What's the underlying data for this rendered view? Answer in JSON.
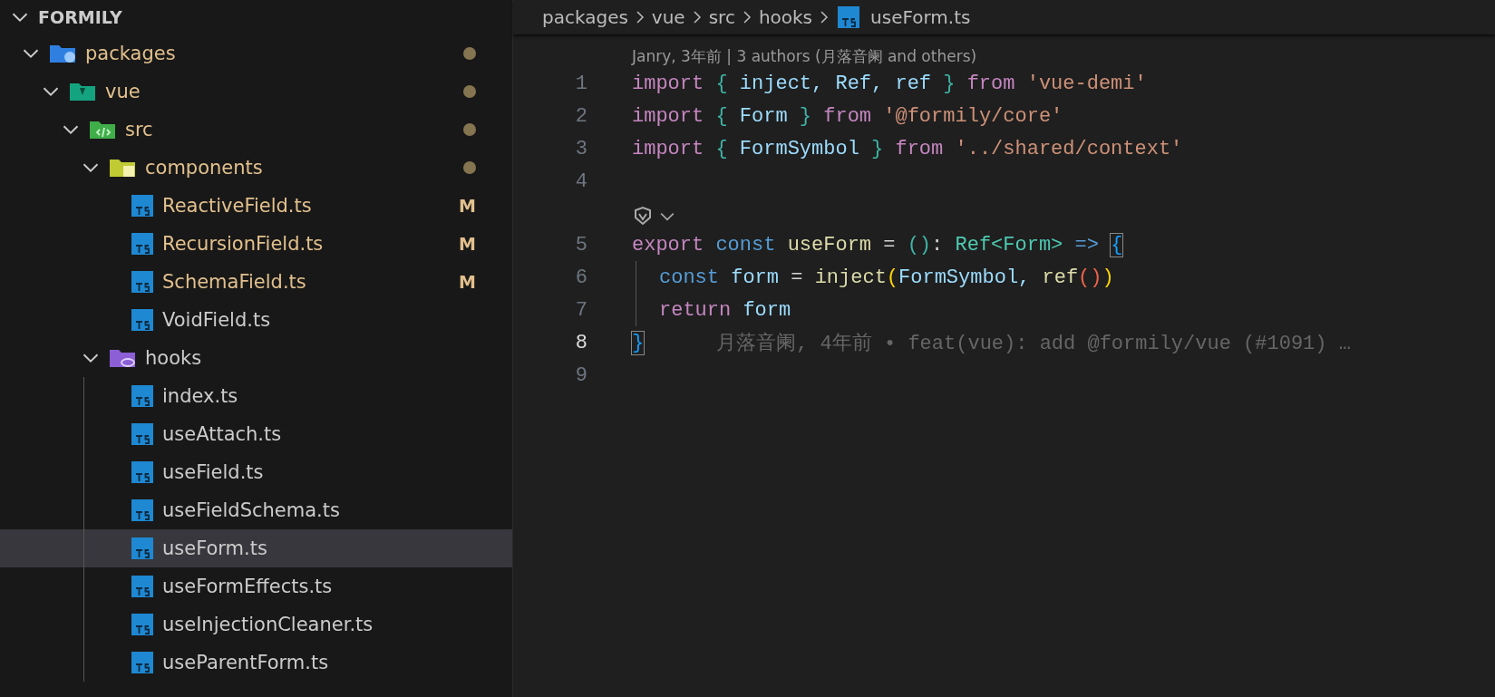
{
  "explorer": {
    "title": "FORMILY",
    "expanded": true,
    "tree": [
      {
        "name": "packages",
        "kind": "package-folder",
        "expanded": true,
        "modified": true,
        "selected": false,
        "children": [
          {
            "name": "vue",
            "kind": "vue-folder",
            "expanded": true,
            "modified": true,
            "selected": false,
            "children": [
              {
                "name": "src",
                "kind": "src-folder",
                "expanded": true,
                "modified": true,
                "selected": false,
                "children": [
                  {
                    "name": "components",
                    "kind": "components-folder",
                    "expanded": true,
                    "modified": true,
                    "selected": false,
                    "children": [
                      {
                        "name": "ReactiveField.ts",
                        "kind": "ts-file",
                        "badge": "M",
                        "selected": false
                      },
                      {
                        "name": "RecursionField.ts",
                        "kind": "ts-file",
                        "badge": "M",
                        "selected": false
                      },
                      {
                        "name": "SchemaField.ts",
                        "kind": "ts-file",
                        "badge": "M",
                        "selected": false
                      },
                      {
                        "name": "VoidField.ts",
                        "kind": "ts-file",
                        "selected": false
                      }
                    ]
                  },
                  {
                    "name": "hooks",
                    "kind": "hooks-folder",
                    "expanded": true,
                    "modified": false,
                    "selected": false,
                    "children": [
                      {
                        "name": "index.ts",
                        "kind": "ts-file",
                        "selected": false
                      },
                      {
                        "name": "useAttach.ts",
                        "kind": "ts-file",
                        "selected": false
                      },
                      {
                        "name": "useField.ts",
                        "kind": "ts-file",
                        "selected": false
                      },
                      {
                        "name": "useFieldSchema.ts",
                        "kind": "ts-file",
                        "selected": false
                      },
                      {
                        "name": "useForm.ts",
                        "kind": "ts-file",
                        "selected": true
                      },
                      {
                        "name": "useFormEffects.ts",
                        "kind": "ts-file",
                        "selected": false
                      },
                      {
                        "name": "useInjectionCleaner.ts",
                        "kind": "ts-file",
                        "selected": false
                      },
                      {
                        "name": "useParentForm.ts",
                        "kind": "ts-file",
                        "selected": false
                      }
                    ]
                  }
                ]
              }
            ]
          }
        ]
      }
    ]
  },
  "breadcrumb": [
    {
      "label": "packages",
      "kind": "folder"
    },
    {
      "label": "vue",
      "kind": "folder"
    },
    {
      "label": "src",
      "kind": "folder"
    },
    {
      "label": "hooks",
      "kind": "folder"
    },
    {
      "label": "useForm.ts",
      "kind": "ts-file"
    }
  ],
  "editor": {
    "lines": [
      {
        "kind": "codelens",
        "text": "Janry, 3年前 | 3 authors (月落音阑 and others)"
      },
      {
        "kind": "code",
        "number": "1",
        "current": false,
        "tokens": [
          {
            "text": "import ",
            "kind": "keyword"
          },
          {
            "text": "{",
            "kind": "bracket-a"
          },
          {
            "text": " inject, Ref, ref ",
            "kind": "variable"
          },
          {
            "text": "}",
            "kind": "bracket-a"
          },
          {
            "text": " from ",
            "kind": "keyword"
          },
          {
            "text": "'vue-demi'",
            "kind": "string"
          }
        ]
      },
      {
        "kind": "code",
        "number": "2",
        "current": false,
        "tokens": [
          {
            "text": "import ",
            "kind": "keyword"
          },
          {
            "text": "{",
            "kind": "bracket-a"
          },
          {
            "text": " Form ",
            "kind": "variable"
          },
          {
            "text": "}",
            "kind": "bracket-a"
          },
          {
            "text": " from ",
            "kind": "keyword"
          },
          {
            "text": "'@formily/core'",
            "kind": "string"
          }
        ]
      },
      {
        "kind": "code",
        "number": "3",
        "current": false,
        "tokens": [
          {
            "text": "import ",
            "kind": "keyword"
          },
          {
            "text": "{",
            "kind": "bracket-a"
          },
          {
            "text": " FormSymbol ",
            "kind": "variable"
          },
          {
            "text": "}",
            "kind": "bracket-a"
          },
          {
            "text": " from ",
            "kind": "keyword"
          },
          {
            "text": "'../shared/context'",
            "kind": "string"
          }
        ]
      },
      {
        "kind": "code",
        "number": "4",
        "current": false
      },
      {
        "kind": "copilot"
      },
      {
        "kind": "code",
        "number": "5",
        "current": false,
        "tokens": [
          {
            "text": "export ",
            "kind": "keyword"
          },
          {
            "text": "const ",
            "kind": "storage"
          },
          {
            "text": "useForm",
            "kind": "function"
          },
          {
            "text": " = ",
            "kind": "plain"
          },
          {
            "text": "()",
            "kind": "bracket-a"
          },
          {
            "text": ": ",
            "kind": "plain"
          },
          {
            "text": "Ref<Form>",
            "kind": "type"
          },
          {
            "text": " => ",
            "kind": "storage"
          },
          {
            "text": "{",
            "kind": "bracket-b",
            "matched": true
          }
        ]
      },
      {
        "kind": "code",
        "number": "6",
        "current": false,
        "indent": true,
        "tokens": [
          {
            "text": "const ",
            "kind": "storage"
          },
          {
            "text": "form",
            "kind": "variable"
          },
          {
            "text": " = ",
            "kind": "plain"
          },
          {
            "text": "inject",
            "kind": "function"
          },
          {
            "text": "(",
            "kind": "bracket-c"
          },
          {
            "text": "FormSymbol, ",
            "kind": "variable"
          },
          {
            "text": "ref",
            "kind": "function"
          },
          {
            "text": "()",
            "kind": "bracket-d"
          },
          {
            "text": ")",
            "kind": "bracket-c"
          }
        ]
      },
      {
        "kind": "code",
        "number": "7",
        "current": false,
        "indent": true,
        "tokens": [
          {
            "text": "return ",
            "kind": "keyword"
          },
          {
            "text": "form",
            "kind": "variable"
          }
        ]
      },
      {
        "kind": "code",
        "number": "8",
        "current": true,
        "tokens": [
          {
            "text": "}",
            "kind": "bracket-b",
            "matched": true
          }
        ],
        "blame": "月落音阑, 4年前 • feat(vue): add @formily/vue (#1091) …"
      },
      {
        "kind": "code",
        "number": "9",
        "current": false
      }
    ]
  }
}
